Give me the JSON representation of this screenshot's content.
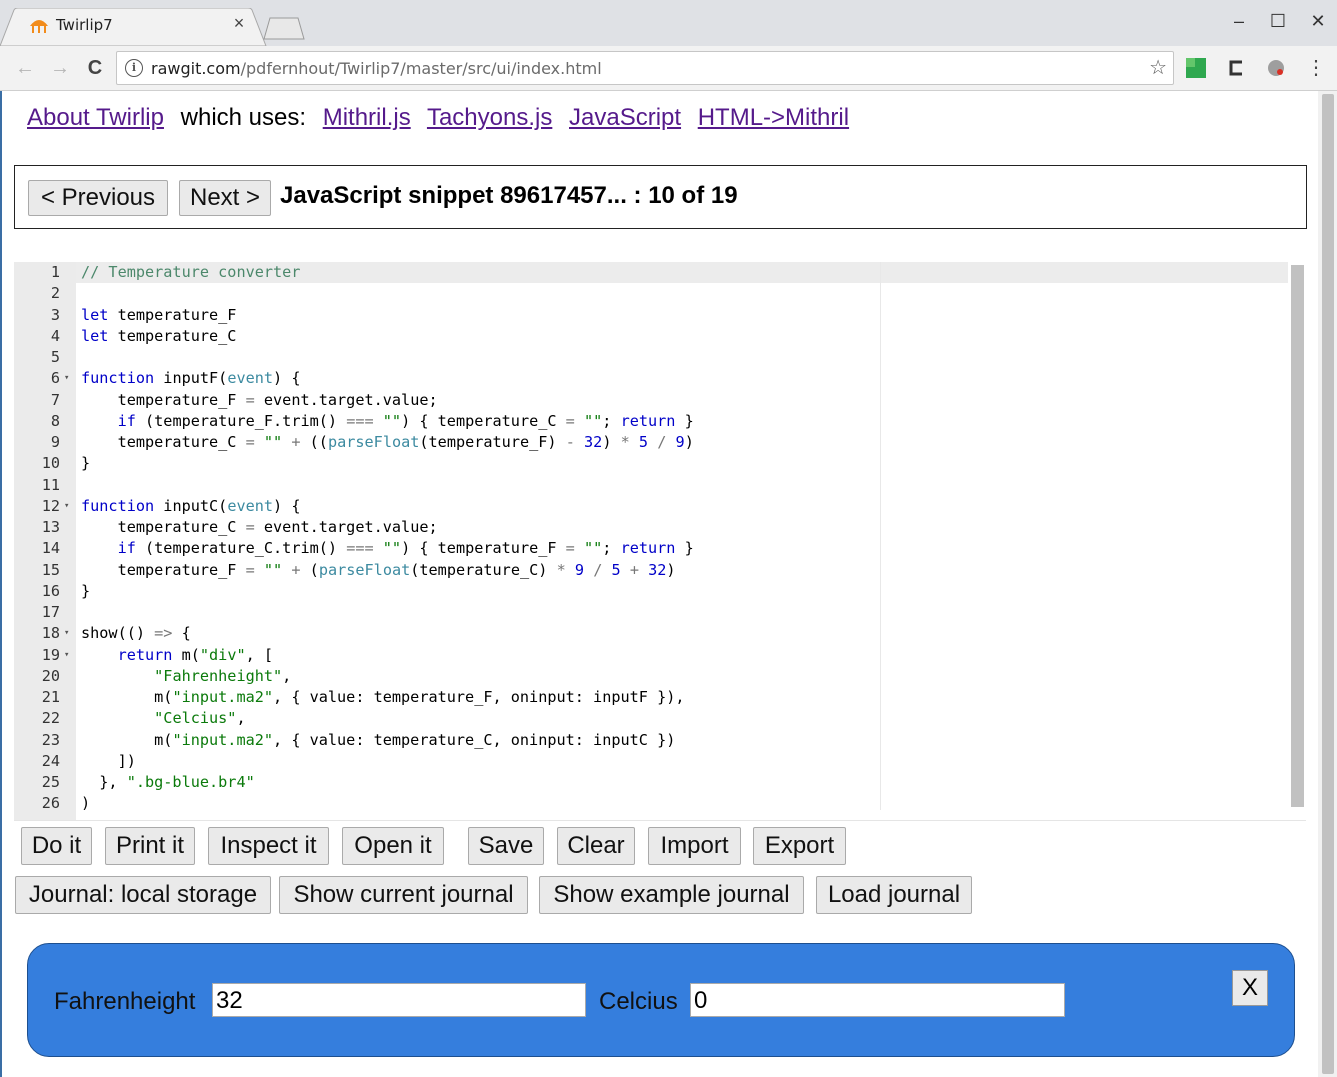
{
  "browser": {
    "tab_title": "Twirlip7",
    "tab_close": "×",
    "url_host": "rawgit.com",
    "url_path": "/pdfernhout/Twirlip7/master/src/ui/index.html",
    "window_controls": {
      "minimize": "–",
      "maximize": "☐",
      "close": "✕"
    },
    "nav": {
      "back": "←",
      "forward": "→",
      "reload": "C"
    },
    "menu": "⋮",
    "star": "☆"
  },
  "header": {
    "about_link": "About Twirlip",
    "which_uses": "which uses:",
    "links": [
      "Mithril.js",
      "Tachyons.js",
      "JavaScript",
      "HTML->Mithril"
    ]
  },
  "navbar": {
    "previous": "< Previous",
    "next": "Next >",
    "snippet_title": "JavaScript snippet 89617457... : 10 of 19"
  },
  "editor": {
    "line_numbers": [
      "1",
      "2",
      "3",
      "4",
      "5",
      "6",
      "7",
      "8",
      "9",
      "10",
      "11",
      "12",
      "13",
      "14",
      "15",
      "16",
      "17",
      "18",
      "19",
      "20",
      "21",
      "22",
      "23",
      "24",
      "25",
      "26"
    ],
    "folds": [
      "",
      "",
      "",
      "",
      "",
      "▾",
      "",
      "",
      "",
      "",
      "",
      "▾",
      "",
      "",
      "",
      "",
      "",
      "▾",
      "▾",
      "",
      "",
      "",
      "",
      "",
      "",
      ""
    ],
    "lines": [
      "// Temperature converter",
      "",
      "let temperature_F",
      "let temperature_C",
      "",
      "function inputF(event) {",
      "    temperature_F = event.target.value;",
      "    if (temperature_F.trim() === \"\") { temperature_C = \"\"; return }",
      "    temperature_C = \"\" + ((parseFloat(temperature_F) - 32) * 5 / 9)",
      "}",
      "",
      "function inputC(event) {",
      "    temperature_C = event.target.value;",
      "    if (temperature_C.trim() === \"\") { temperature_F = \"\"; return }",
      "    temperature_F = \"\" + (parseFloat(temperature_C) * 9 / 5 + 32)",
      "}",
      "",
      "show(() => {",
      "    return m(\"div\", [",
      "        \"Fahrenheight\",",
      "        m(\"input.ma2\", { value: temperature_F, oninput: inputF }),",
      "        \"Celcius\",",
      "        m(\"input.ma2\", { value: temperature_C, oninput: inputC })",
      "    ])",
      "  }, \".bg-blue.br4\"",
      ")"
    ]
  },
  "actions": {
    "row1": [
      "Do it",
      "Print it",
      "Inspect it",
      "Open it",
      "Save",
      "Clear",
      "Import",
      "Export"
    ],
    "row2": [
      "Journal: local storage",
      "Show current journal",
      "Show example journal",
      "Load journal"
    ]
  },
  "output": {
    "fahrenheit_label": "Fahrenheight",
    "fahrenheit_value": "32",
    "celcius_label": "Celcius",
    "celcius_value": "0",
    "close": "X"
  },
  "colors": {
    "output_bg": "#357edd",
    "link": "#551a8b",
    "keyword": "#0000c8",
    "comment": "#4c886b",
    "string": "#0b7a0b"
  }
}
